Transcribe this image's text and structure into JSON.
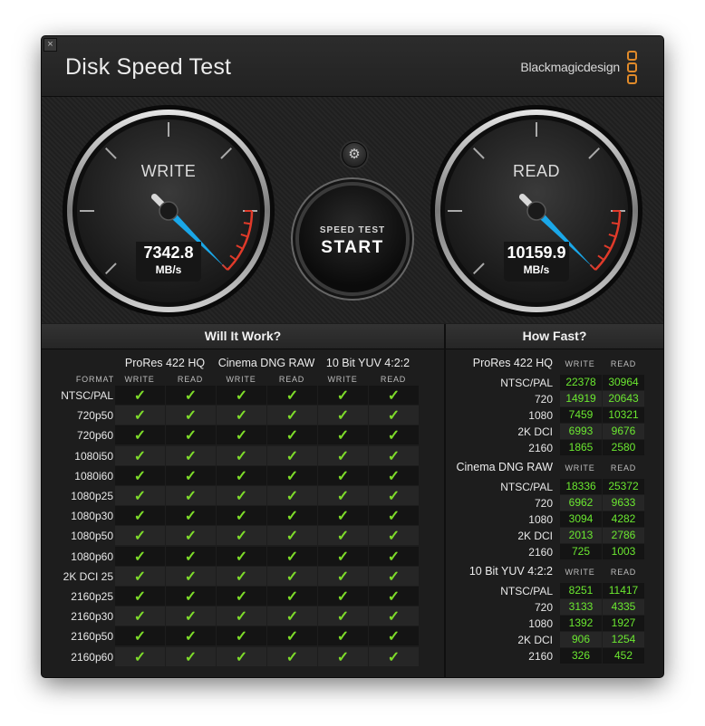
{
  "app": {
    "title": "Disk Speed Test",
    "brand": "Blackmagicdesign",
    "close_label": "×"
  },
  "gauges": {
    "write": {
      "label": "WRITE",
      "value": "7342.8",
      "unit": "MB/s"
    },
    "read": {
      "label": "READ",
      "value": "10159.9",
      "unit": "MB/s"
    }
  },
  "controls": {
    "start_top": "SPEED TEST",
    "start_main": "START",
    "settings_icon": "gear-icon"
  },
  "will_it_work": {
    "title": "Will It Work?",
    "format_label": "FORMAT",
    "write_label": "WRITE",
    "read_label": "READ",
    "codecs": [
      "ProRes 422 HQ",
      "Cinema DNG RAW",
      "10 Bit YUV 4:2:2"
    ],
    "check_glyph": "✓",
    "rows": [
      "NTSC/PAL",
      "720p50",
      "720p60",
      "1080i50",
      "1080i60",
      "1080p25",
      "1080p30",
      "1080p50",
      "1080p60",
      "2K DCI 25",
      "2160p25",
      "2160p30",
      "2160p50",
      "2160p60"
    ]
  },
  "how_fast": {
    "title": "How Fast?",
    "write_label": "WRITE",
    "read_label": "READ",
    "sections": [
      {
        "name": "ProRes 422 HQ",
        "rows": [
          {
            "format": "NTSC/PAL",
            "write": "22378",
            "read": "30964"
          },
          {
            "format": "720",
            "write": "14919",
            "read": "20643"
          },
          {
            "format": "1080",
            "write": "7459",
            "read": "10321"
          },
          {
            "format": "2K DCI",
            "write": "6993",
            "read": "9676"
          },
          {
            "format": "2160",
            "write": "1865",
            "read": "2580"
          }
        ]
      },
      {
        "name": "Cinema DNG RAW",
        "rows": [
          {
            "format": "NTSC/PAL",
            "write": "18336",
            "read": "25372"
          },
          {
            "format": "720",
            "write": "6962",
            "read": "9633"
          },
          {
            "format": "1080",
            "write": "3094",
            "read": "4282"
          },
          {
            "format": "2K DCI",
            "write": "2013",
            "read": "2786"
          },
          {
            "format": "2160",
            "write": "725",
            "read": "1003"
          }
        ]
      },
      {
        "name": "10 Bit YUV 4:2:2",
        "rows": [
          {
            "format": "NTSC/PAL",
            "write": "8251",
            "read": "11417"
          },
          {
            "format": "720",
            "write": "3133",
            "read": "4335"
          },
          {
            "format": "1080",
            "write": "1392",
            "read": "1927"
          },
          {
            "format": "2K DCI",
            "write": "906",
            "read": "1254"
          },
          {
            "format": "2160",
            "write": "326",
            "read": "452"
          }
        ]
      }
    ]
  },
  "colors": {
    "accent_needle": "#1aa7e8",
    "check": "#7edb2a",
    "number": "#6be830",
    "redline": "#e03a2a",
    "brand_logo": "#e08a2a"
  }
}
